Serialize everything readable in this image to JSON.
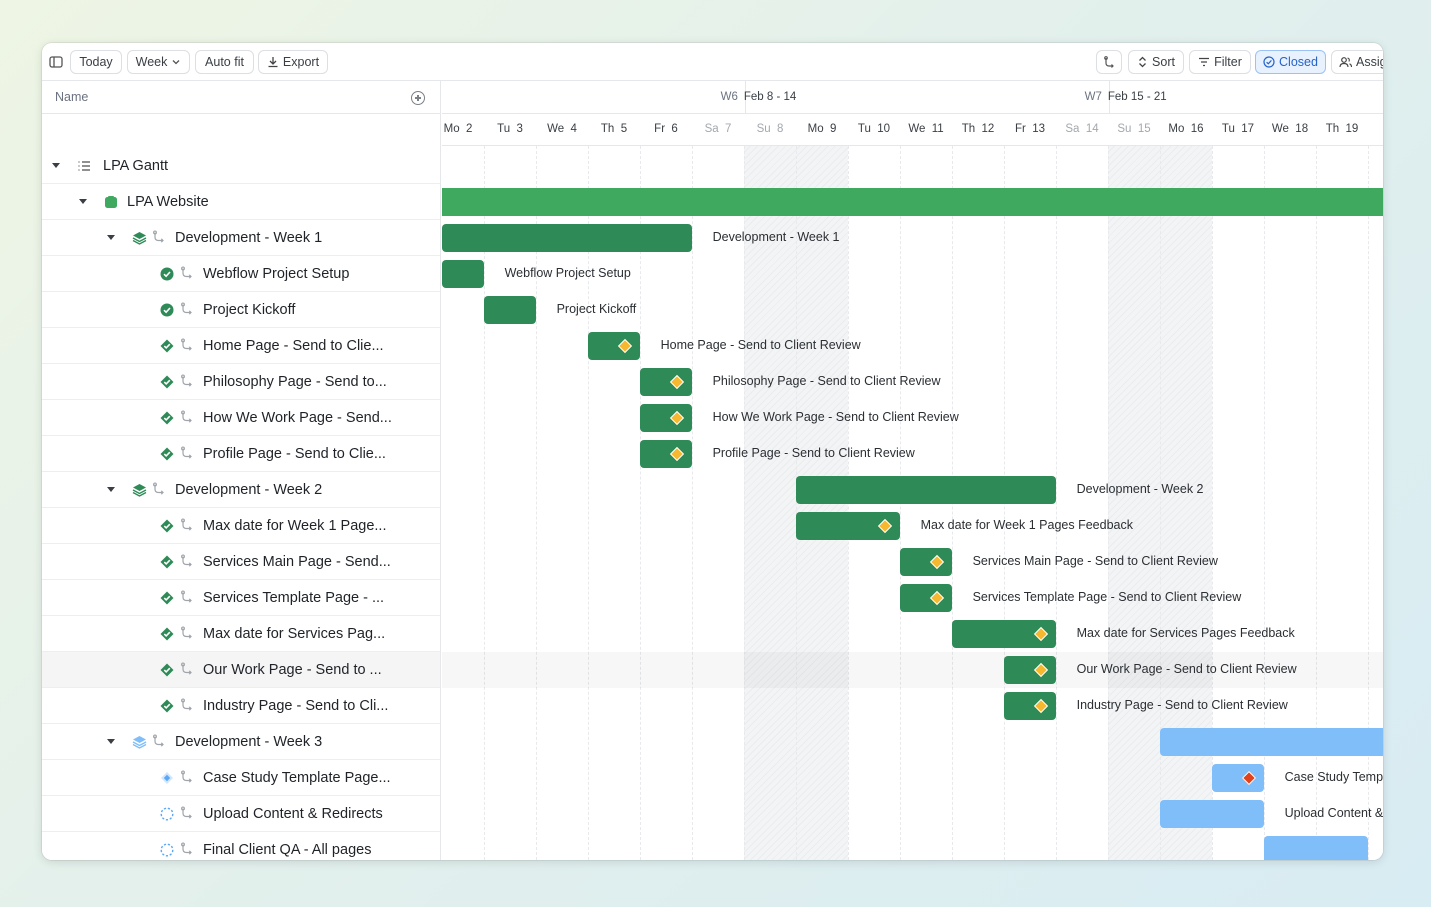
{
  "toolbar": {
    "today": "Today",
    "week": "Week",
    "auto_fit": "Auto fit",
    "export": "Export",
    "sort": "Sort",
    "filter": "Filter",
    "closed": "Closed",
    "assignee": "Assig"
  },
  "left": {
    "name_header": "Name"
  },
  "timeline": {
    "weeks": [
      {
        "week": "W6",
        "range": "Feb 8 - 14"
      },
      {
        "week": "W7",
        "range": "Feb 15 - 21"
      }
    ],
    "days": [
      {
        "label": "Mo  2",
        "weekend": false
      },
      {
        "label": "Tu  3",
        "weekend": false
      },
      {
        "label": "We  4",
        "weekend": false
      },
      {
        "label": "Th  5",
        "weekend": false
      },
      {
        "label": "Fr  6",
        "weekend": false
      },
      {
        "label": "Sa  7",
        "weekend": true
      },
      {
        "label": "Su  8",
        "weekend": true
      },
      {
        "label": "Mo  9",
        "weekend": false
      },
      {
        "label": "Tu  10",
        "weekend": false
      },
      {
        "label": "We  11",
        "weekend": false
      },
      {
        "label": "Th  12",
        "weekend": false
      },
      {
        "label": "Fr  13",
        "weekend": false
      },
      {
        "label": "Sa  14",
        "weekend": true
      },
      {
        "label": "Su  15",
        "weekend": true
      },
      {
        "label": "Mo  16",
        "weekend": false
      },
      {
        "label": "Tu  17",
        "weekend": false
      },
      {
        "label": "We  18",
        "weekend": false
      },
      {
        "label": "Th  19",
        "weekend": false
      },
      {
        "label": "F",
        "weekend": false
      }
    ],
    "project_progress": 0.914
  },
  "rows": [
    {
      "name": "LPA Gantt",
      "type": "root",
      "status": "list"
    },
    {
      "name": "LPA Website",
      "type": "project",
      "status": "project"
    },
    {
      "name": "Development - Week 1",
      "type": "group",
      "status": "stack-done",
      "bar_label": "Development - Week 1"
    },
    {
      "name": "Webflow Project Setup",
      "type": "task",
      "status": "done-circle",
      "bar_label": "Webflow Project Setup"
    },
    {
      "name": "Project Kickoff",
      "type": "task",
      "status": "done-circle",
      "bar_label": "Project Kickoff"
    },
    {
      "name": "Home Page - Send to Clie...",
      "type": "task",
      "status": "done-diamond",
      "bar_label": "Home Page - Send to Client Review"
    },
    {
      "name": "Philosophy Page - Send to...",
      "type": "task",
      "status": "done-diamond",
      "bar_label": "Philosophy Page - Send to Client Review"
    },
    {
      "name": "How We Work Page - Send...",
      "type": "task",
      "status": "done-diamond",
      "bar_label": "How We Work Page - Send to Client Review"
    },
    {
      "name": "Profile Page - Send to Clie...",
      "type": "task",
      "status": "done-diamond",
      "bar_label": "Profile Page - Send to Client Review"
    },
    {
      "name": "Development - Week 2",
      "type": "group",
      "status": "stack-done",
      "bar_label": "Development - Week 2"
    },
    {
      "name": "Max date for Week 1 Page...",
      "type": "task",
      "status": "done-diamond",
      "bar_label": "Max date for Week 1 Pages Feedback"
    },
    {
      "name": "Services Main Page - Send...",
      "type": "task",
      "status": "done-diamond",
      "bar_label": "Services Main Page - Send to Client Review"
    },
    {
      "name": "Services Template Page - ...",
      "type": "task",
      "status": "done-diamond",
      "bar_label": "Services Template Page - Send to Client Review"
    },
    {
      "name": "Max date for Services Pag...",
      "type": "task",
      "status": "done-diamond",
      "bar_label": "Max date for Services Pages Feedback"
    },
    {
      "name": "Our Work Page - Send to ...",
      "type": "task",
      "status": "done-diamond",
      "bar_label": "Our Work Page - Send to Client Review",
      "highlight": true
    },
    {
      "name": "Industry Page - Send to Cli...",
      "type": "task",
      "status": "done-diamond",
      "bar_label": "Industry Page - Send to Client Review"
    },
    {
      "name": "Development - Week 3",
      "type": "group",
      "status": "stack-plan",
      "bar_label": ""
    },
    {
      "name": "Case Study Template Page...",
      "type": "task",
      "status": "plan-diamond",
      "bar_label": "Case Study Temp"
    },
    {
      "name": "Upload Content & Redirects",
      "type": "task",
      "status": "plan-circle",
      "bar_label": "Upload Content &"
    },
    {
      "name": "Final Client QA - All pages",
      "type": "task",
      "status": "plan-circle",
      "bar_label": ""
    }
  ],
  "bars": [
    {
      "row": 1,
      "start": 0,
      "days": 18.5,
      "kind": "proj"
    },
    {
      "row": 2,
      "start": 0,
      "days": 4.8,
      "kind": "done"
    },
    {
      "row": 3,
      "start": 0,
      "days": 0.8,
      "kind": "done"
    },
    {
      "row": 4,
      "start": 0.8,
      "days": 1,
      "kind": "done"
    },
    {
      "row": 5,
      "start": 2.8,
      "days": 1,
      "kind": "done",
      "milestone": "yellow"
    },
    {
      "row": 6,
      "start": 3.8,
      "days": 1,
      "kind": "done",
      "milestone": "yellow"
    },
    {
      "row": 7,
      "start": 3.8,
      "days": 1,
      "kind": "done",
      "milestone": "yellow"
    },
    {
      "row": 8,
      "start": 3.8,
      "days": 1,
      "kind": "done",
      "milestone": "yellow"
    },
    {
      "row": 9,
      "start": 6.8,
      "days": 5,
      "kind": "done"
    },
    {
      "row": 10,
      "start": 6.8,
      "days": 2,
      "kind": "done",
      "milestone": "yellow"
    },
    {
      "row": 11,
      "start": 8.8,
      "days": 1,
      "kind": "done",
      "milestone": "yellow"
    },
    {
      "row": 12,
      "start": 8.8,
      "days": 1,
      "kind": "done",
      "milestone": "yellow"
    },
    {
      "row": 13,
      "start": 9.8,
      "days": 2,
      "kind": "done",
      "milestone": "yellow"
    },
    {
      "row": 14,
      "start": 10.8,
      "days": 1,
      "kind": "done",
      "milestone": "yellow"
    },
    {
      "row": 15,
      "start": 10.8,
      "days": 1,
      "kind": "done",
      "milestone": "yellow"
    },
    {
      "row": 16,
      "start": 13.8,
      "days": 5,
      "kind": "plan"
    },
    {
      "row": 17,
      "start": 14.8,
      "days": 1,
      "kind": "plan",
      "milestone": "red"
    },
    {
      "row": 18,
      "start": 13.8,
      "days": 2,
      "kind": "plan"
    },
    {
      "row": 19,
      "start": 15.8,
      "days": 2,
      "kind": "plan"
    }
  ],
  "colors": {
    "done": "#2e8b57",
    "planned": "#7fbef9",
    "project": "#3fa95f",
    "progress": "#5fc140",
    "milestone": "#f5b82e",
    "milestone_late": "#e0431c",
    "closed_accent": "#2563c9"
  }
}
